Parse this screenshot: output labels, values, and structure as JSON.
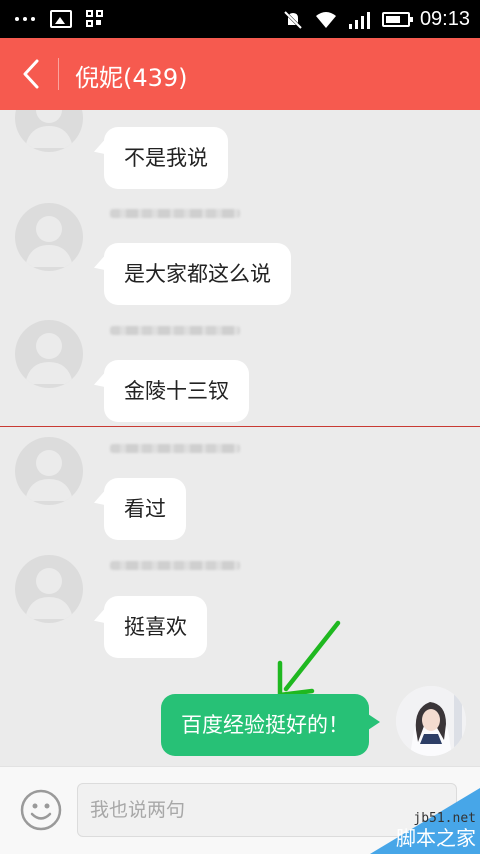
{
  "status_bar": {
    "time": "09:13",
    "icons": [
      "more-dots-icon",
      "image-icon",
      "qr-code-icon",
      "mute-icon",
      "wifi-icon",
      "signal-icon",
      "battery-icon"
    ]
  },
  "header": {
    "title": "倪妮(439)",
    "back_icon": "chevron-left-icon",
    "color": "#f65a4f"
  },
  "messages": [
    {
      "side": "left",
      "text": "不是我说"
    },
    {
      "side": "left",
      "text": "是大家都这么说"
    },
    {
      "side": "left",
      "text": "金陵十三钗"
    },
    {
      "side": "left",
      "text": "看过"
    },
    {
      "side": "left",
      "text": "挺喜欢"
    },
    {
      "side": "right",
      "text": "百度经验挺好的！"
    }
  ],
  "input": {
    "placeholder": "我也说两句",
    "emoji_icon": "smiley-icon"
  },
  "colors": {
    "sent_bubble": "#27c176",
    "arrow_annotation": "#1fb820",
    "divider": "#c83a33"
  },
  "watermark": {
    "site": "jb51.net",
    "name": "脚本之家"
  }
}
